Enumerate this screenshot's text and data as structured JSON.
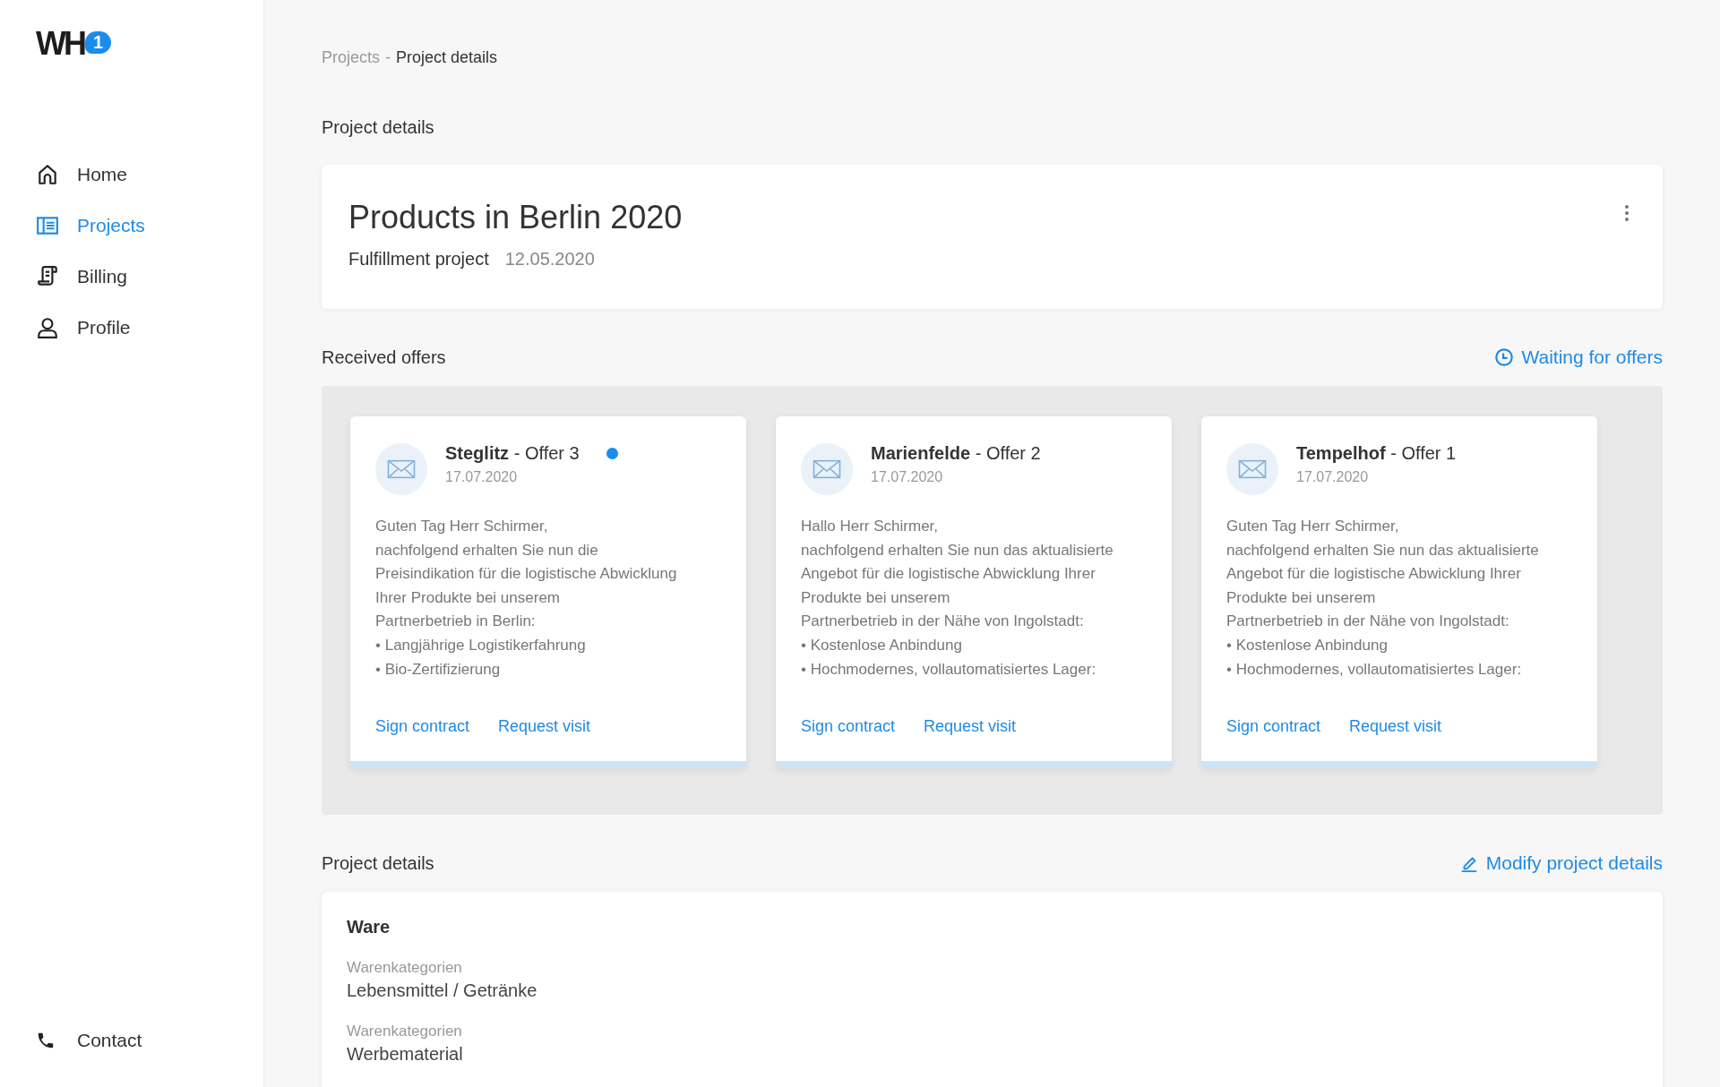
{
  "logo": {
    "text": "WH",
    "badge": "1"
  },
  "nav": [
    {
      "label": "Home",
      "selected": false
    },
    {
      "label": "Projects",
      "selected": true
    },
    {
      "label": "Billing",
      "selected": false
    },
    {
      "label": "Profile",
      "selected": false
    }
  ],
  "contact": {
    "label": "Contact"
  },
  "breadcrumb": [
    {
      "label": "Projects",
      "selected": false
    },
    {
      "label": "Project details",
      "selected": true
    }
  ],
  "breadcrumb_separator": "-",
  "project_section_title": "Project details",
  "project": {
    "title": "Products in Berlin 2020",
    "type": "Fulfillment project",
    "date": "12.05.2020"
  },
  "offers_section": {
    "title": "Received offers",
    "status": "Waiting for offers"
  },
  "offers": [
    {
      "title": "**Steglitz** - Offer 3",
      "date": "17.07.2020",
      "unread": true,
      "body": [
        "Guten Tag Herr Schirmer,",
        "nachfolgend erhalten Sie nun die",
        "Preisindikation für die logistische Abwicklung",
        "Ihrer Produkte bei unserem",
        "Partnerbetrieb in Berlin:",
        "• Langjährige Logistikerfahrung",
        "• Bio-Zertifizierung"
      ],
      "actions": [
        "Sign contract",
        "Request visit"
      ]
    },
    {
      "title": "**Marienfelde** - Offer 2",
      "date": "17.07.2020",
      "unread": false,
      "body": [
        "Hallo Herr Schirmer,",
        "nachfolgend erhalten Sie nun das aktualisierte",
        "Angebot für die logistische Abwicklung Ihrer",
        "Produkte bei unserem",
        "Partnerbetrieb in der Nähe von Ingolstadt:",
        "• Kostenlose Anbindung",
        "• Hochmodernes, vollautomatisiertes Lager:"
      ],
      "actions": [
        "Sign contract",
        "Request visit"
      ]
    },
    {
      "title": "**Tempelhof** - Offer 1",
      "date": "17.07.2020",
      "unread": false,
      "body": [
        "Guten Tag Herr Schirmer,",
        "nachfolgend erhalten Sie nun das aktualisierte",
        "Angebot für die logistische Abwicklung Ihrer",
        "Produkte bei unserem",
        "Partnerbetrieb in der Nähe von Ingolstadt:",
        "• Kostenlose Anbindung",
        "• Hochmodernes, vollautomatisiertes Lager:"
      ],
      "actions": [
        "Sign contract",
        "Request visit"
      ]
    }
  ],
  "details_section": {
    "title": "Project details",
    "action": "Modify project details"
  },
  "details": {
    "heading": "Ware",
    "fields": [
      {
        "label": "Warenkategorien",
        "value": "Lebensmittel / Getränke"
      },
      {
        "label": "Warenkategorien",
        "value": "Werbematerial"
      }
    ]
  }
}
